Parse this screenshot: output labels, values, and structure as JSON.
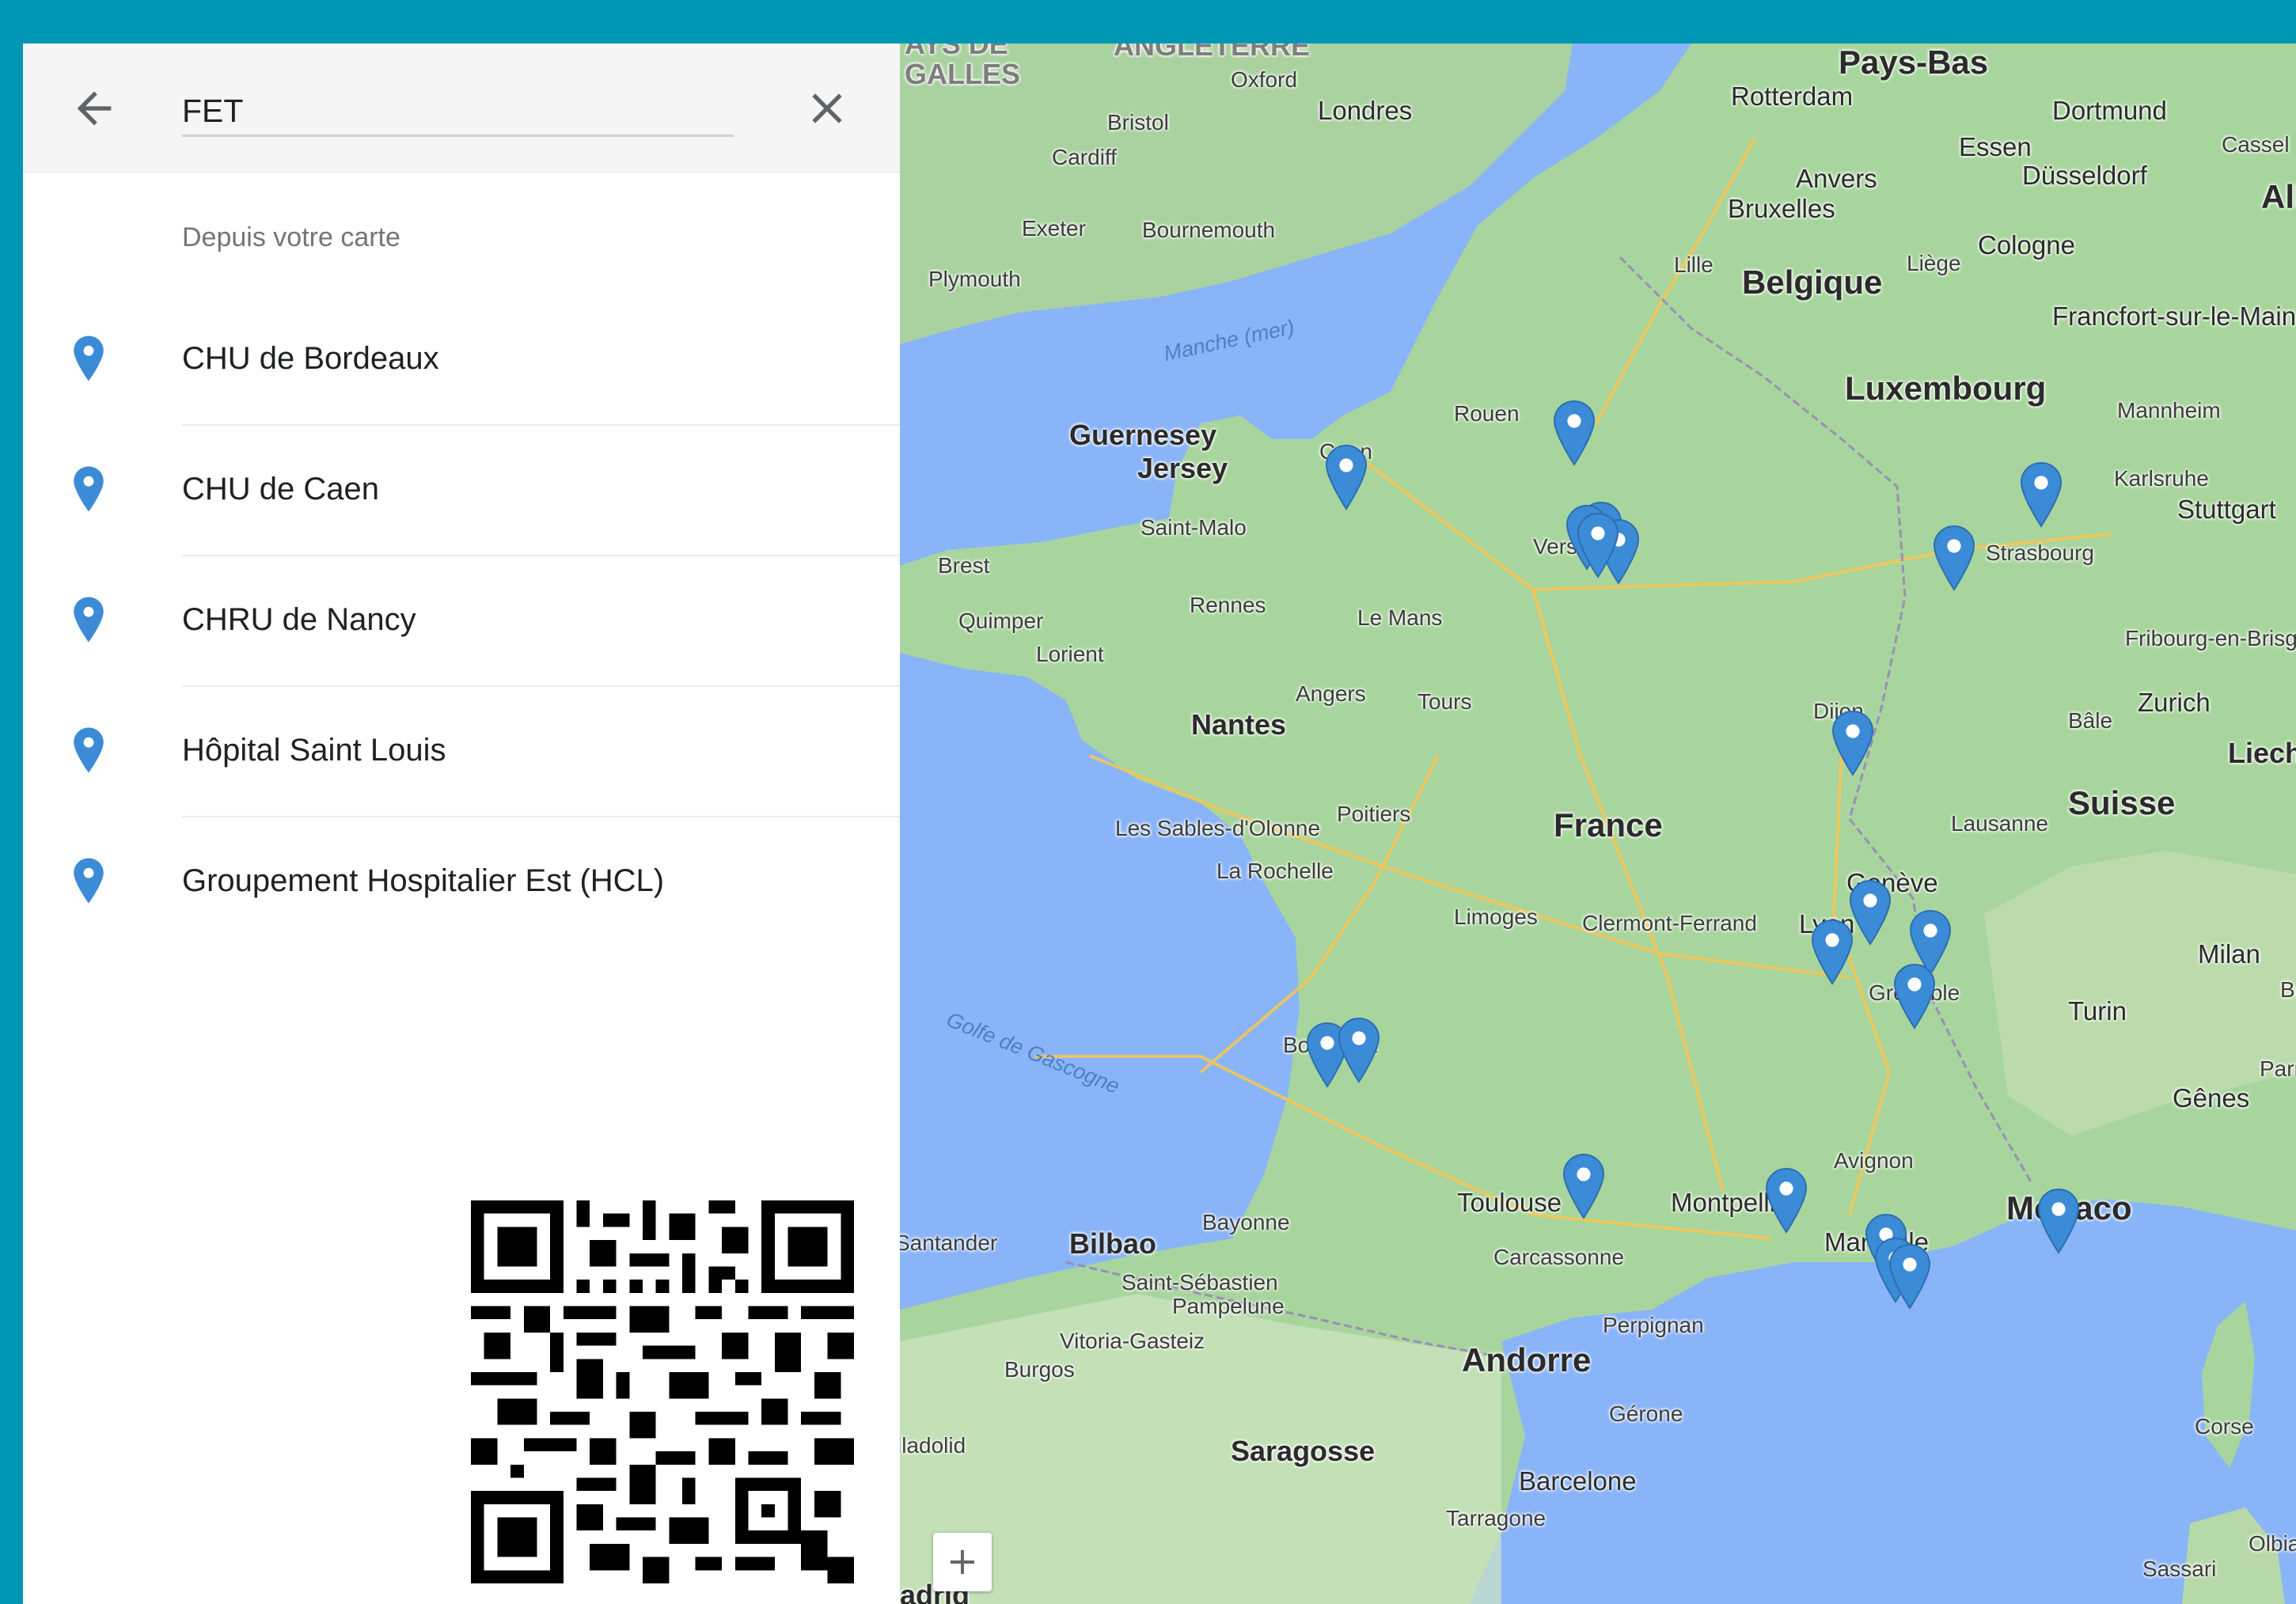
{
  "search": {
    "value": "FET",
    "back_icon": "arrow-left-icon",
    "clear_icon": "close-icon"
  },
  "results": {
    "header": "Depuis votre carte",
    "items": [
      {
        "label": "CHU de Bordeaux"
      },
      {
        "label": "CHU de Caen"
      },
      {
        "label": "CHRU de Nancy"
      },
      {
        "label": "Hôpital Saint Louis"
      },
      {
        "label": "Groupement Hospitalier Est (HCL)"
      }
    ]
  },
  "map": {
    "zoom_in_label": "+",
    "pin_color": "#3b8bd6",
    "labels": {
      "pays_de_galles": "AYS DE\nGALLES",
      "angleterre": "ANGLETERRE",
      "pays_bas": "Pays-Bas",
      "rotterdam": "Rotterdam",
      "dortmund": "Dortmund",
      "cassel": "Cassel",
      "alle": "Alle",
      "oxford": "Oxford",
      "londres": "Londres",
      "bristol": "Bristol",
      "cardiff": "Cardiff",
      "essen": "Essen",
      "anvers": "Anvers",
      "dusseldorf": "Düsseldorf",
      "bruxelles": "Bruxelles",
      "exeter": "Exeter",
      "bournemouth": "Bournemouth",
      "plymouth": "Plymouth",
      "lille": "Lille",
      "belgique": "Belgique",
      "liege": "Liège",
      "cologne": "Cologne",
      "francfort": "Francfort-sur-le-Main",
      "manche": "Manche (mer)",
      "luxembourg": "Luxembourg",
      "guernesey": "Guernesey",
      "jersey": "Jersey",
      "rouen": "Rouen",
      "caen": "Caen",
      "mannheim": "Mannheim",
      "karlsruhe": "Karlsruhe",
      "stuttgart": "Stuttgart",
      "saint_malo": "Saint-Malo",
      "versailles": "Versailles",
      "strasbourg": "Strasbourg",
      "brest": "Brest",
      "rennes": "Rennes",
      "le_mans": "Le Mans",
      "quimper": "Quimper",
      "lorient": "Lorient",
      "fribourg": "Fribourg-en-Brisgau",
      "angers": "Angers",
      "tours": "Tours",
      "nantes": "Nantes",
      "dijon": "Dijon",
      "bale": "Bâle",
      "zurich": "Zurich",
      "liech": "Liecht",
      "poitiers": "Poitiers",
      "france": "France",
      "sables": "Les Sables-d'Olonne",
      "rochelle": "La Rochelle",
      "lausanne": "Lausanne",
      "suisse": "Suisse",
      "geneve": "Genève",
      "limoges": "Limoges",
      "clermont": "Clermont-Ferrand",
      "lyon": "Lyon",
      "golfe": "Golfe de Gascogne",
      "milan": "Milan",
      "br": "Br",
      "grenoble": "Grenoble",
      "turin": "Turin",
      "bordeaux": "Bordeaux",
      "parm": "Parm",
      "genes": "Gênes",
      "avignon": "Avignon",
      "toulouse": "Toulouse",
      "montpellier": "Montpellier",
      "monaco": "Monaco",
      "bayonne": "Bayonne",
      "santander": "Santander",
      "bilbao": "Bilbao",
      "carcassonne": "Carcassonne",
      "marseille": "Marseille",
      "saint_sebastien": "Saint-Sébastien",
      "pampelune": "Pampelune",
      "perpignan": "Perpignan",
      "vitoria": "Vitoria-Gasteiz",
      "burgos": "Burgos",
      "andorre": "Andorre",
      "corse": "Corse",
      "gerone": "Gérone",
      "lladolid": "lladolid",
      "saragosse": "Saragosse",
      "barcelone": "Barcelone",
      "olbia": "Olbia",
      "tarragone": "Tarragone",
      "sassari": "Sassari",
      "adrid": "adrid"
    }
  }
}
